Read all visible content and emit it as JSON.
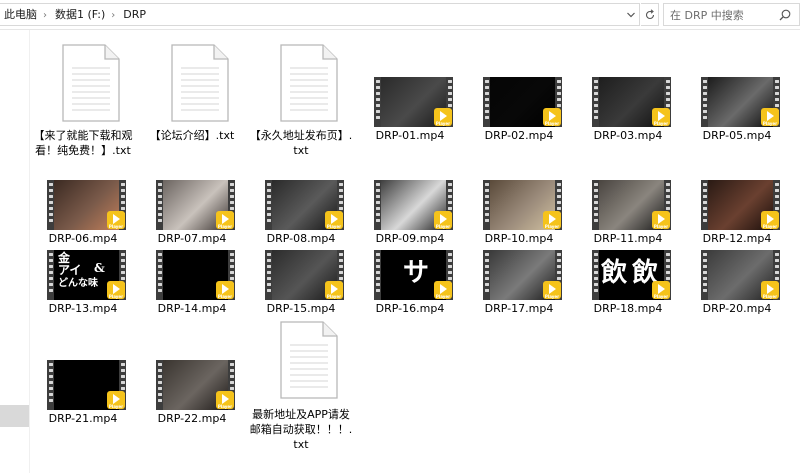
{
  "address_bar": {
    "breadcrumbs": [
      "此电脑",
      "数据1 (F:)",
      "DRP"
    ],
    "separator": "›"
  },
  "search": {
    "placeholder": "在 DRP 中搜索"
  },
  "colors": {
    "badge": "#f5c31b",
    "nav_selection": "#d9d9d9"
  },
  "files": [
    {
      "name": "【来了就能下载和观看！纯免费！】.txt",
      "type": "txt"
    },
    {
      "name": "【论坛介绍】.txt",
      "type": "txt"
    },
    {
      "name": "【永久地址发布页】.txt",
      "type": "txt"
    },
    {
      "name": "DRP-01.mp4",
      "type": "mp4"
    },
    {
      "name": "DRP-02.mp4",
      "type": "mp4"
    },
    {
      "name": "DRP-03.mp4",
      "type": "mp4"
    },
    {
      "name": "DRP-05.mp4",
      "type": "mp4"
    },
    {
      "name": "DRP-06.mp4",
      "type": "mp4"
    },
    {
      "name": "DRP-07.mp4",
      "type": "mp4"
    },
    {
      "name": "DRP-08.mp4",
      "type": "mp4"
    },
    {
      "name": "DRP-09.mp4",
      "type": "mp4"
    },
    {
      "name": "DRP-10.mp4",
      "type": "mp4"
    },
    {
      "name": "DRP-11.mp4",
      "type": "mp4"
    },
    {
      "name": "DRP-12.mp4",
      "type": "mp4"
    },
    {
      "name": "DRP-13.mp4",
      "type": "mp4"
    },
    {
      "name": "DRP-14.mp4",
      "type": "mp4"
    },
    {
      "name": "DRP-15.mp4",
      "type": "mp4"
    },
    {
      "name": "DRP-16.mp4",
      "type": "mp4"
    },
    {
      "name": "DRP-17.mp4",
      "type": "mp4"
    },
    {
      "name": "DRP-18.mp4",
      "type": "mp4"
    },
    {
      "name": "DRP-20.mp4",
      "type": "mp4"
    },
    {
      "name": "DRP-21.mp4",
      "type": "mp4"
    },
    {
      "name": "DRP-22.mp4",
      "type": "mp4"
    },
    {
      "name": "最新地址及APP请发邮箱自动获取！！！.txt",
      "type": "txt"
    }
  ],
  "thumb_badge_text": "Player",
  "thumb_texts": {
    "DRP-13.mp4": [
      "金",
      "アイ",
      "&",
      "どんな味"
    ],
    "DRP-16.mp4": [
      "サ"
    ],
    "DRP-18.mp4": [
      "飲",
      "飲"
    ]
  }
}
